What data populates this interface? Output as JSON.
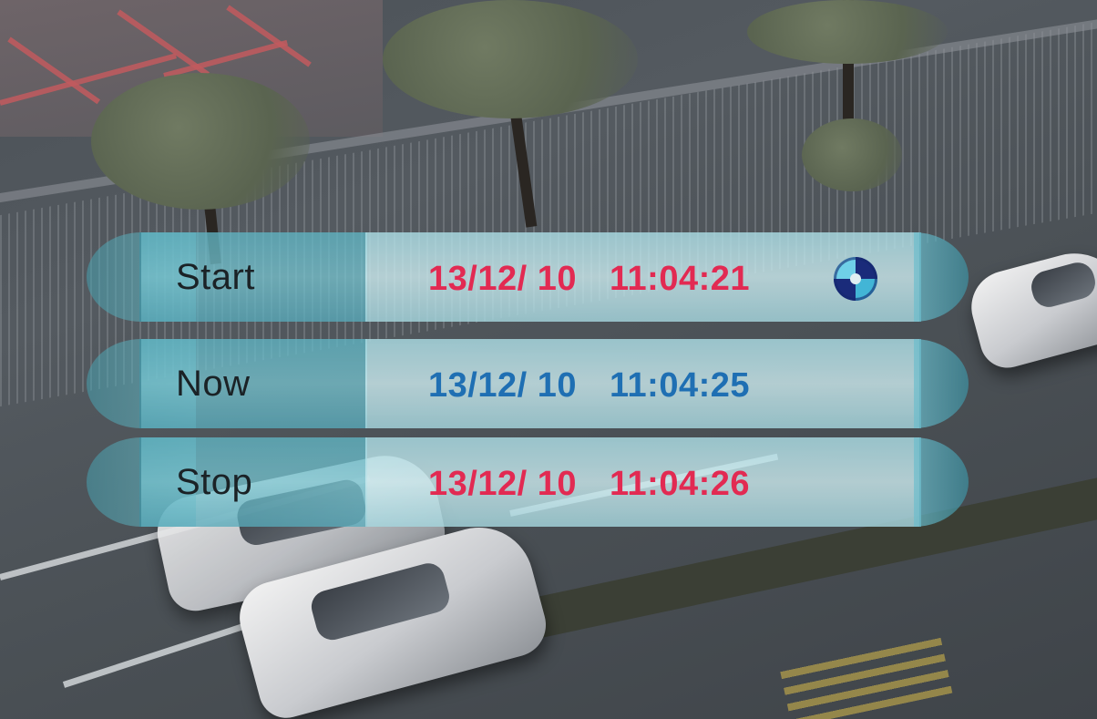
{
  "osd": {
    "rows": [
      {
        "label": "Start",
        "date": "13/12/ 10",
        "time": "11:04:21",
        "color": "#e22a52"
      },
      {
        "label": "Now",
        "date": "13/12/ 10",
        "time": "11:04:25",
        "color": "#1f6fb3"
      },
      {
        "label": "Stop",
        "date": "13/12/ 10",
        "time": "11:04:26",
        "color": "#e22a52"
      }
    ],
    "icon": "disc-icon"
  }
}
